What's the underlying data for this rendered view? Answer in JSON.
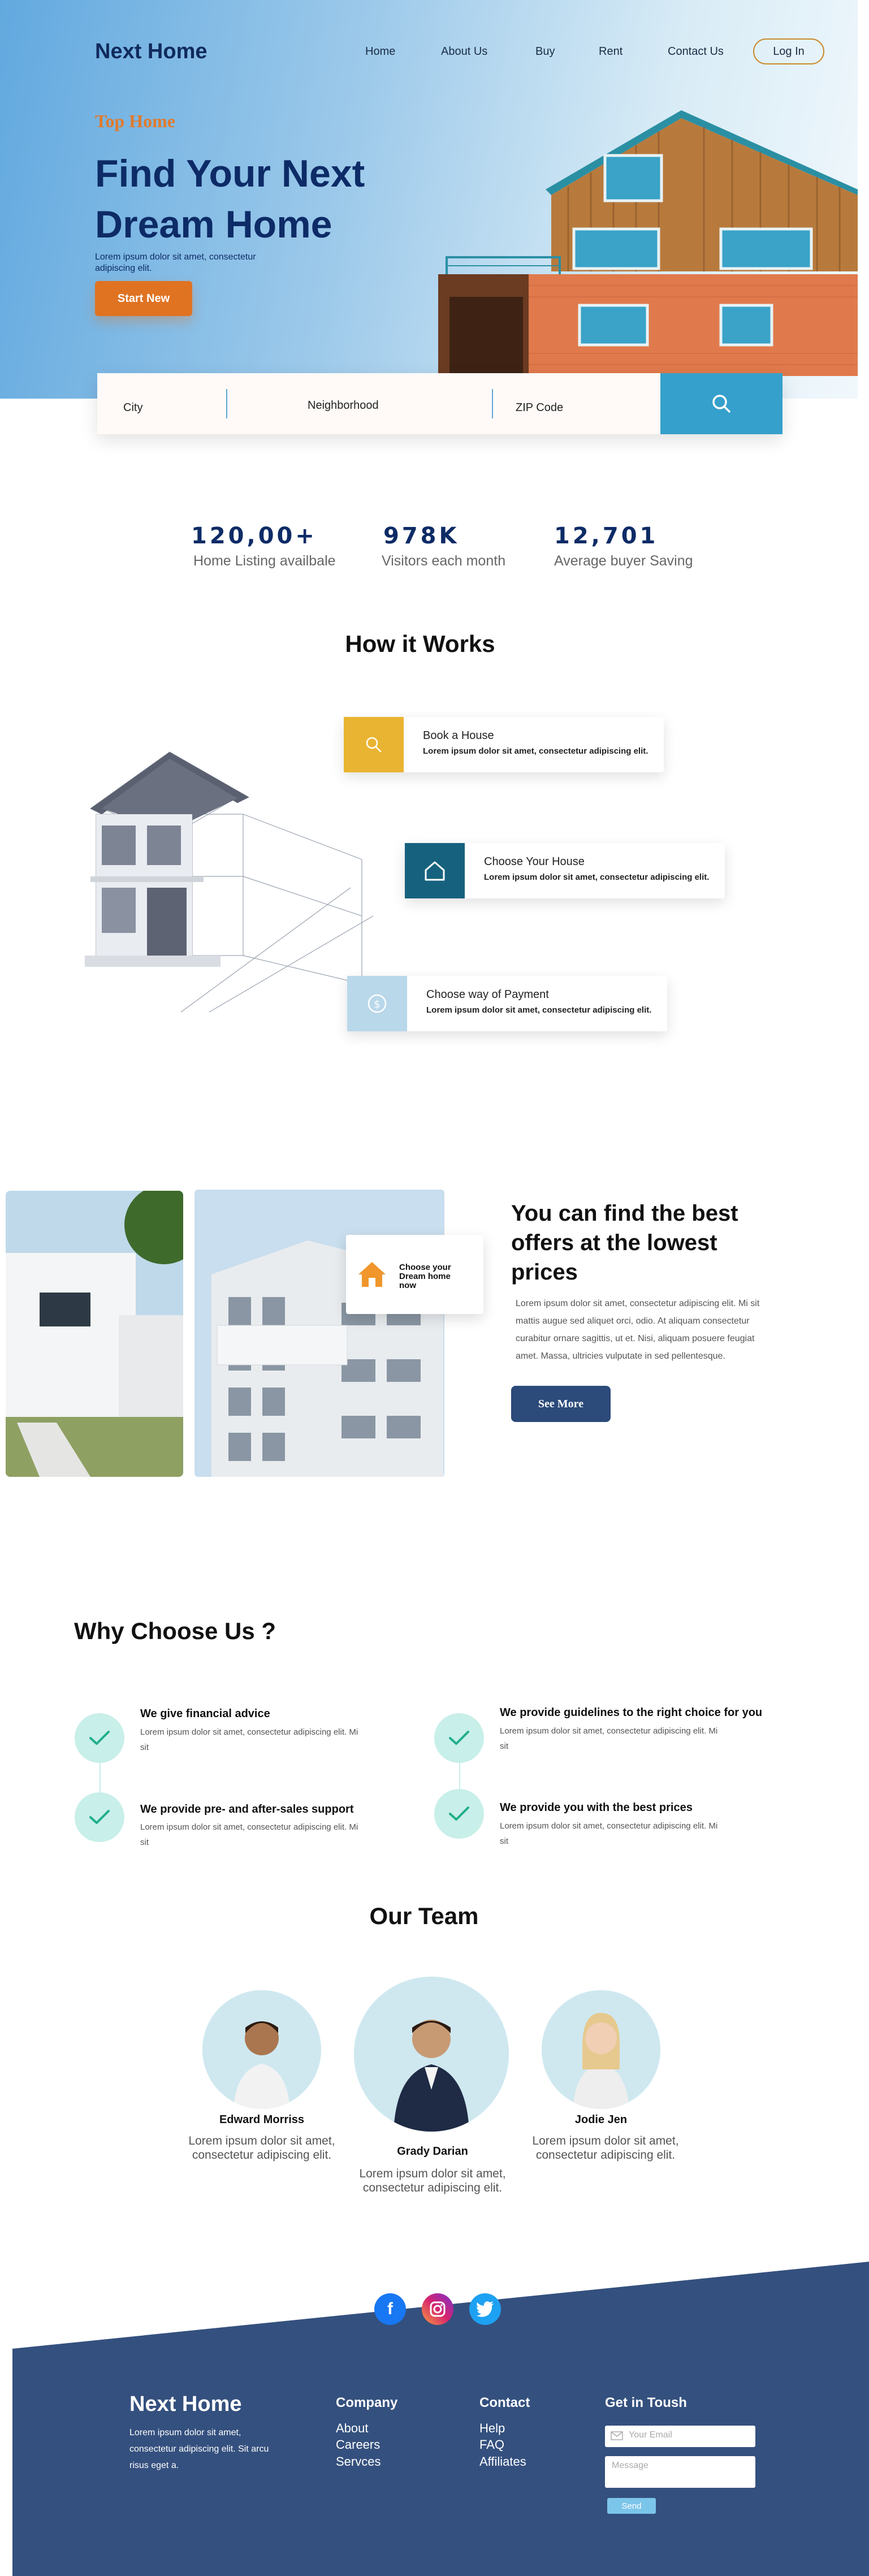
{
  "brand": "Next Home",
  "nav": {
    "items": [
      "Home",
      "About Us",
      "Buy",
      "Rent",
      "Contact Us"
    ],
    "login": "Log In"
  },
  "hero": {
    "tagline": "Top Home",
    "title_line1": "Find Your Next",
    "title_line2": "Dream Home",
    "subtitle": "Lorem ipsum dolor sit amet, consectetur adipiscing elit.",
    "cta": "Start New"
  },
  "search": {
    "city": "City",
    "neighborhood": "Neighborhood",
    "zip": "ZIP Code",
    "icon": "search-icon"
  },
  "stats": [
    {
      "value": "120,00+",
      "label": "Home Listing availbale"
    },
    {
      "value": "978K",
      "label": "Visitors each month"
    },
    {
      "value": "12,701",
      "label": "Average buyer Saving"
    }
  ],
  "how": {
    "title": "How it Works",
    "steps": [
      {
        "title": "Book a House",
        "desc": "Lorem ipsum dolor sit amet, consectetur adipiscing elit.",
        "icon": "search-icon",
        "color": "#e9b431"
      },
      {
        "title": "Choose Your House",
        "desc": "Lorem ipsum dolor sit amet, consectetur adipiscing elit.",
        "icon": "home-icon",
        "color": "#16627e"
      },
      {
        "title": "Choose way of Payment",
        "desc": "Lorem ipsum dolor sit amet, consectetur adipiscing elit.",
        "icon": "dollar-icon",
        "color": "#b9d8ea"
      }
    ]
  },
  "offers": {
    "badge": "Choose your Dream home now",
    "title": "You can find the best offers at the lowest prices",
    "text": "Lorem ipsum dolor sit amet, consectetur adipiscing elit. Mi sit mattis augue sed aliquet orci, odio. At aliquam consectetur curabitur ornare sagittis, ut et. Nisi, aliquam posuere feugiat amet. Massa, ultricies vulputate in sed pellentesque.",
    "cta": "See More"
  },
  "why": {
    "title": "Why Choose Us ?",
    "items": [
      {
        "title": "We give  financial advice",
        "text": "Lorem ipsum dolor sit amet, consectetur adipiscing elit. Mi sit"
      },
      {
        "title": "We provide guidelines to the right choice for you",
        "text": "Lorem ipsum dolor sit amet, consectetur adipiscing elit. Mi sit"
      },
      {
        "title": "We provide pre- and after-sales support",
        "text": "Lorem ipsum dolor sit amet, consectetur adipiscing elit. Mi sit"
      },
      {
        "title": "We provide you with the best prices",
        "text": "Lorem ipsum dolor sit amet, consectetur adipiscing elit. Mi sit"
      }
    ]
  },
  "team": {
    "title": "Our Team",
    "members": [
      {
        "name": "Edward Morriss",
        "text": "Lorem ipsum dolor sit amet, consectetur adipiscing elit."
      },
      {
        "name": "Grady Darian",
        "text": "Lorem ipsum dolor sit amet, consectetur adipiscing elit."
      },
      {
        "name": "Jodie Jen",
        "text": "Lorem ipsum dolor sit amet, consectetur adipiscing elit."
      }
    ]
  },
  "footer": {
    "brand": "Next Home",
    "text": "Lorem ipsum dolor sit amet, consectetur adipiscing elit. Sit arcu risus eget a.",
    "company_title": "Company",
    "company_links": [
      "About",
      "Careers",
      "Servces"
    ],
    "contact_title": "Contact",
    "contact_links": [
      "Help",
      "FAQ",
      "Affiliates"
    ],
    "touch_title": "Get in Toush",
    "email_placeholder": "Your Email",
    "message_placeholder": "Message",
    "send": "Send",
    "bg_color": "#34507e"
  },
  "colors": {
    "navy": "#0d2b66",
    "orange": "#e07322",
    "teal": "#35a0cb"
  }
}
